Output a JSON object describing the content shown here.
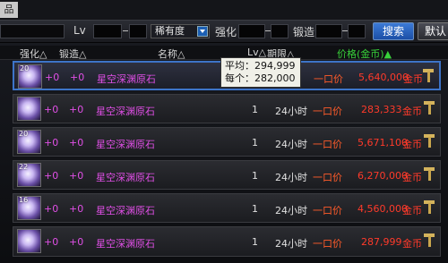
{
  "window": {
    "tab_label": "品"
  },
  "filters": {
    "lv_label": "Lv",
    "rarity_value": "稀有度",
    "strength_label": "强化",
    "lock_label": "锻造",
    "search_button": "搜索",
    "default_button": "默认"
  },
  "columns": {
    "strength": "强化△",
    "lock": "锻造△",
    "name": "名称△",
    "lv": "Lv△",
    "time": "期限△",
    "price": "价格(金币)▲"
  },
  "tooltip": {
    "avg_label": "平均：",
    "avg_value": "294,999",
    "each_label": "每个：",
    "each_value": "282,000"
  },
  "rows": [
    {
      "count": "20",
      "strength": "+0",
      "lock": "+0",
      "name": "星空深渊原石",
      "lv": "",
      "time": "",
      "price_type": "一口价",
      "price": "5,640,000",
      "currency": "金币"
    },
    {
      "count": "",
      "strength": "+0",
      "lock": "+0",
      "name": "星空深渊原石",
      "lv": "1",
      "time": "24小时",
      "price_type": "一口价",
      "price": "283,333",
      "currency": "金币"
    },
    {
      "count": "20",
      "strength": "+0",
      "lock": "+0",
      "name": "星空深渊原石",
      "lv": "1",
      "time": "24小时",
      "price_type": "一口价",
      "price": "5,671,100",
      "currency": "金币"
    },
    {
      "count": "22",
      "strength": "+0",
      "lock": "+0",
      "name": "星空深渊原石",
      "lv": "1",
      "time": "24小时",
      "price_type": "一口价",
      "price": "6,270,000",
      "currency": "金币"
    },
    {
      "count": "16",
      "strength": "+0",
      "lock": "+0",
      "name": "星空深渊原石",
      "lv": "1",
      "time": "24小时",
      "price_type": "一口价",
      "price": "4,560,000",
      "currency": "金币"
    },
    {
      "count": "",
      "strength": "+0",
      "lock": "+0",
      "name": "星空深渊原石",
      "lv": "1",
      "time": "24小时",
      "price_type": "一口价",
      "price": "287,999",
      "currency": "金币"
    }
  ]
}
